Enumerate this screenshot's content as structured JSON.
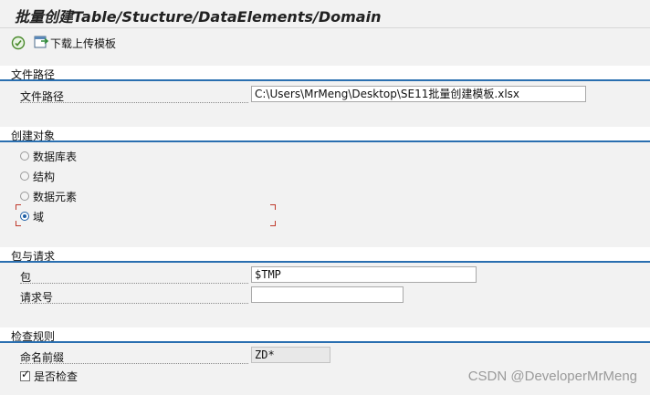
{
  "window": {
    "title": "批量创建Table/Stucture/DataElements/Domain"
  },
  "toolbar": {
    "execute_icon": "execute-icon",
    "download_icon": "download-template-icon",
    "download_label": "下载上传模板"
  },
  "file_section": {
    "header": "文件路径",
    "path_label": "文件路径",
    "path_value": "C:\\Users\\MrMeng\\Desktop\\SE11批量创建模板.xlsx"
  },
  "object_section": {
    "header": "创建对象",
    "options": [
      {
        "label": "数据库表",
        "selected": false
      },
      {
        "label": "结构",
        "selected": false
      },
      {
        "label": "数据元素",
        "selected": false
      },
      {
        "label": "域",
        "selected": true
      }
    ]
  },
  "package_section": {
    "header": "包与请求",
    "package_label": "包",
    "package_value": "$TMP",
    "request_label": "请求号",
    "request_value": ""
  },
  "check_section": {
    "header": "检查规则",
    "prefix_label": "命名前缀",
    "prefix_value": "ZD*",
    "check_label": "是否检查",
    "check_checked": true
  },
  "watermark": "CSDN @DeveloperMrMeng",
  "colors": {
    "section_line": "#2a6fb0",
    "panel_bg": "#f2f2f2",
    "focus_marker": "#c0392b"
  }
}
